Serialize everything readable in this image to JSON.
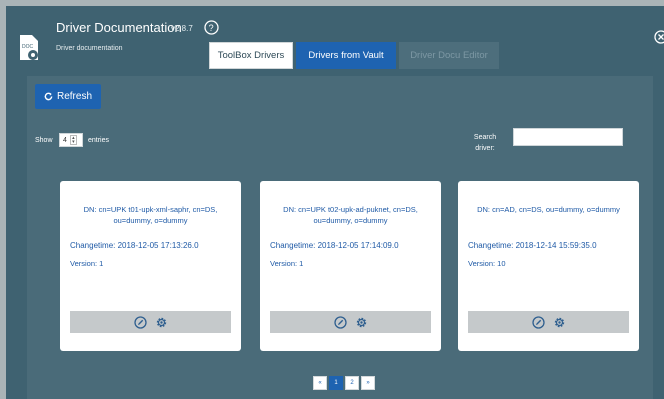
{
  "header": {
    "title": "Driver Documentation",
    "version": "v2.8.7",
    "subtitle": "Driver documentation",
    "icon": "document-gear-icon",
    "help_icon": "help-circle-icon",
    "close_icon": "close-circle-icon"
  },
  "tabs": [
    {
      "label": "ToolBox Drivers",
      "state": "default"
    },
    {
      "label": "Drivers from Vault",
      "state": "active"
    },
    {
      "label": "Driver Docu Editor",
      "state": "disabled"
    }
  ],
  "toolbar": {
    "refresh_label": "Refresh",
    "show_label": "Show",
    "entries_value": "4",
    "entries_label": "entries",
    "search_label": "Search driver:",
    "search_value": ""
  },
  "cards": [
    {
      "dn": "DN: cn=UPK t01-upk-xml-saphr, cn=DS, ou=dummy, o=dummy",
      "changetime": "Changetime: 2018-12-05 17:13:26.0",
      "version": "Version: 1"
    },
    {
      "dn": "DN: cn=UPK t02-upk-ad-puknet, cn=DS, ou=dummy, o=dummy",
      "changetime": "Changetime: 2018-12-05 17:14:09.0",
      "version": "Version: 1"
    },
    {
      "dn": "DN: cn=AD, cn=DS, ou=dummy, o=dummy",
      "changetime": "Changetime: 2018-12-14 15:59:35.0",
      "version": "Version: 10"
    }
  ],
  "pagination": {
    "prev": "«",
    "pages": [
      "1",
      "2"
    ],
    "current": "1",
    "next": "»"
  },
  "colors": {
    "background": "#3f6271",
    "accent": "#1e63b1",
    "text_blue": "#1f5aa6"
  }
}
